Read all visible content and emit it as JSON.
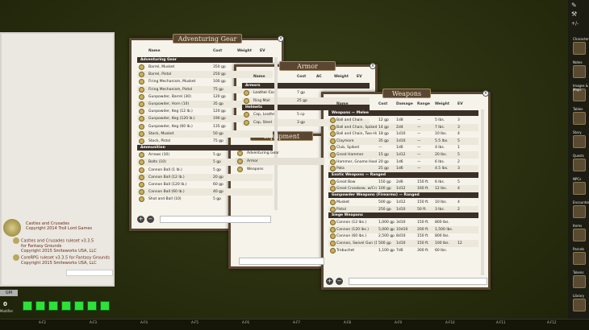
{
  "library": {
    "items": [
      {
        "title": "Castles and Crusades",
        "subtitle": "Copyright 2014 Troll Lord Games"
      },
      {
        "title": "Castles and Crusades ruleset v3.3.5",
        "subtitle": "for Fantasy Grounds"
      },
      {
        "title": "",
        "subtitle": "Copyright 2015 Smiteworks USA, LLC"
      },
      {
        "title": "CoreRPG ruleset v3.3.5 for Fantasy Grounds",
        "subtitle": "Copyright 2015 Smiteworks USA, LLC"
      }
    ],
    "mode_label": "GM",
    "hotbar_number": "0",
    "hotbar_label": "Modifier"
  },
  "hotkeys": [
    "A-F2",
    "A-F3",
    "A-F4",
    "A-F5",
    "A-F6",
    "A-F7",
    "A-F8",
    "A-F9",
    "A-F10",
    "A-F11",
    "A-F12"
  ],
  "sidebar": {
    "tools": [
      "✎",
      "⚒",
      "+/-"
    ],
    "labels": [
      "Character",
      "Notes",
      "Images & Maps",
      "Tables",
      "Story",
      "Quests",
      "NPCs",
      "Encounters",
      "Items",
      "Parcels",
      "Tokens",
      "Library"
    ]
  },
  "adventuring": {
    "title": "Adventuring Gear",
    "headers": [
      "Name",
      "Cost",
      "Weight",
      "EV"
    ],
    "groups": [
      {
        "name": "Adventuring Gear",
        "rows": [
          [
            "Barrel, Musket",
            "350 gp",
            "",
            ""
          ],
          [
            "Barrel, Pistol",
            "250 gp",
            "",
            ""
          ],
          [
            "Firing Mechanism, Musket",
            "100 gp",
            "",
            ""
          ],
          [
            "Firing Mechanism, Pistol",
            "75 gp",
            "",
            ""
          ],
          [
            "Gunpowder, Barrel (30)",
            "120 gp",
            "",
            ""
          ],
          [
            "Gunpowder, Horn (10)",
            "35 gp",
            "",
            ""
          ],
          [
            "Gunpowder, Keg (12 lb.)",
            "120 gp",
            "",
            ""
          ],
          [
            "Gunpowder, Keg (120 lb.)",
            "190 gp",
            "",
            ""
          ],
          [
            "Gunpowder, Keg (60 lb.)",
            "135 gp",
            "",
            ""
          ],
          [
            "Stock, Musket",
            "50 gp",
            "",
            ""
          ],
          [
            "Stock, Pistol",
            "75 gp",
            "",
            ""
          ]
        ]
      },
      {
        "name": "Ammunition",
        "rows": [
          [
            "Arrows (10)",
            "5 gp",
            "",
            ""
          ],
          [
            "Bolts (10)",
            "5 gp",
            "",
            ""
          ],
          [
            "Cannon Ball (1 lb.)",
            "5 gp",
            "",
            ""
          ],
          [
            "Cannon Ball (12 lb.)",
            "20 gp",
            "",
            ""
          ],
          [
            "Cannon Ball (120 lb.)",
            "60 gp",
            "",
            ""
          ],
          [
            "Cannon Ball (60 lb.)",
            "40 gp",
            "",
            ""
          ],
          [
            "Shot and Ball (10)",
            "5 gp",
            "",
            ""
          ]
        ]
      }
    ]
  },
  "armor": {
    "title": "Armor",
    "headers": [
      "Name",
      "Cost",
      "AC",
      "Weight",
      "EV"
    ],
    "groups": [
      {
        "name": "Armors",
        "rows": [
          [
            "Leather Coat",
            "7 gp"
          ],
          [
            "Ring Mail",
            "25 gp"
          ]
        ]
      },
      {
        "name": "Helmets",
        "rows": [
          [
            "Cap, Leather",
            "5 cp"
          ],
          [
            "Cap, Steel",
            "3 gp"
          ]
        ]
      }
    ]
  },
  "equipment": {
    "title": "Equipment",
    "items": [
      "Adventuring Gear",
      "Armor",
      "Weapons"
    ]
  },
  "weapons": {
    "title": "Weapons",
    "headers": [
      "Name",
      "Cost",
      "Damage",
      "Range",
      "Weight",
      "EV"
    ],
    "groups": [
      {
        "name": "Weapons — Melee",
        "rows": [
          [
            "Ball and Chain",
            "12 gp",
            "1d8",
            "—",
            "5 lbs.",
            "3"
          ],
          [
            "Ball and Chain, Spiked",
            "14 gp",
            "2d4",
            "—",
            "7 lbs.",
            "3"
          ],
          [
            "Ball and Chain, Two-Handed",
            "18 gp",
            "1d10",
            "—",
            "10 lbs.",
            "4"
          ],
          [
            "Claymore",
            "35 gp",
            "1d10",
            "—",
            "5.5 lbs.",
            "5"
          ],
          [
            "Club, Spiked",
            "—",
            "1d6",
            "—",
            "4 lbs.",
            "1"
          ],
          [
            "Great Hammer",
            "15 gp",
            "1d12",
            "—",
            "20 lbs.",
            "5"
          ],
          [
            "Hammer, Gnome Hook",
            "20 gp",
            "1d6",
            "—",
            "6 lbs.",
            "2"
          ],
          [
            "Pata",
            "25 gp",
            "1d6",
            "—",
            "4.5 lbs.",
            "3"
          ]
        ]
      },
      {
        "name": "Exotic Weapons — Ranged",
        "rows": [
          [
            "Great Bow",
            "150 gp",
            "2d6",
            "150 ft.",
            "6 lbs.",
            "5"
          ],
          [
            "Great Crossbow, w/Crank",
            "100 gp",
            "1d12",
            "160 ft.",
            "12 lbs.",
            "4"
          ]
        ]
      },
      {
        "name": "Gunpowder Weapons (Firearms) — Ranged",
        "rows": [
          [
            "Musket",
            "500 gp",
            "1d12",
            "150 ft.",
            "10 lbs.",
            "4"
          ],
          [
            "Pistol",
            "250 gp",
            "1d10",
            "50 ft.",
            "3 lbs.",
            "2"
          ]
        ]
      },
      {
        "name": "Siege Weapons",
        "rows": [
          [
            "Cannon (12 lbs.)",
            "1,000 gp",
            "3d10",
            "150 ft.",
            "800 lbs.",
            ""
          ],
          [
            "Cannon (120 lbs.)",
            "5,000 gp",
            "10d10",
            "200 ft.",
            "1,500 lbs.",
            ""
          ],
          [
            "Cannon (60 lbs.)",
            "2,500 gp",
            "8d10",
            "150 ft.",
            "800 lbs.",
            ""
          ],
          [
            "Cannon, Swivel Gun (1 lb.)",
            "500 gp",
            "1d10",
            "150 ft.",
            "100 lbs.",
            "12"
          ],
          [
            "Trebuchet",
            "1,100 gp",
            "7d6",
            "300 ft.",
            "60 lbs.",
            ""
          ]
        ]
      }
    ]
  }
}
